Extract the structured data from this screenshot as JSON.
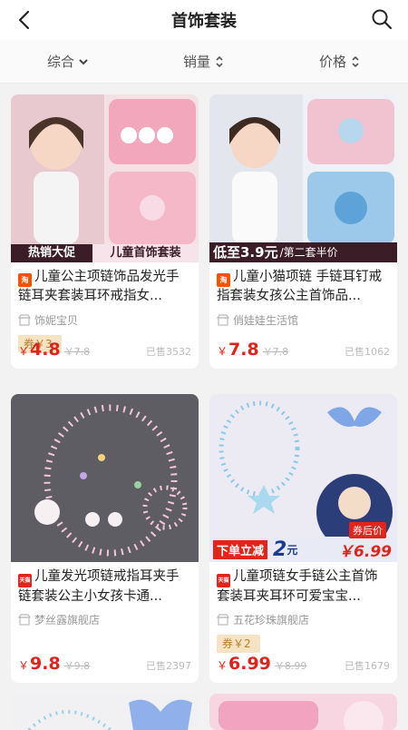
{
  "header": {
    "title": "首饰套装"
  },
  "sort": {
    "items": [
      {
        "label": "综合"
      },
      {
        "label": "销量"
      },
      {
        "label": "价格"
      }
    ]
  },
  "colors": {
    "accent": "#e2231a",
    "coupon_bg": "#f5e3c3",
    "coupon_text": "#b57f2a",
    "taobao_badge": "#ff5000",
    "tmall_badge": "#e1251b"
  },
  "products": [
    {
      "badge": "淘",
      "badge_type": "taobao",
      "name": "儿童公主项链饰品发光手链耳夹套装耳环戒指女...",
      "shop": "饰妮宝贝",
      "coupon": "券￥3",
      "yen": "￥",
      "price": "4.8",
      "old_price": "￥7.8",
      "sold": "已售3532",
      "banner_left": "热销大促",
      "banner_right": "儿童首饰套装"
    },
    {
      "badge": "淘",
      "badge_type": "taobao",
      "name": "儿童小猫项链 手链耳钉戒指套装女孩公主首饰品...",
      "shop": "俏娃娃生活馆",
      "coupon": "",
      "yen": "￥",
      "price": "7.8",
      "old_price": "￥7.8",
      "sold": "已售1062",
      "banner_left": "低至3.9元",
      "banner_right": "/第二套半价"
    },
    {
      "badge": "天猫",
      "badge_type": "tmall",
      "name": "儿童发光项链戒指耳夹手链套装公主小女孩卡通...",
      "shop": "梦丝露旗舰店",
      "coupon": "",
      "yen": "￥",
      "price": "9.8",
      "old_price": "￥9.8",
      "sold": "已售2397"
    },
    {
      "badge": "天猫",
      "badge_type": "tmall",
      "name": "儿童项链女手链公主首饰套装耳夹耳环可爱宝宝...",
      "shop": "五花珍珠旗舰店",
      "coupon": "券￥2",
      "yen": "￥",
      "price": "6.99",
      "old_price": "￥8.99",
      "sold": "已售1679",
      "banner_left": "下单立减",
      "banner_num": "2",
      "banner_unit": "元",
      "banner_tag": "券后价",
      "banner_price": "￥6.99"
    }
  ]
}
